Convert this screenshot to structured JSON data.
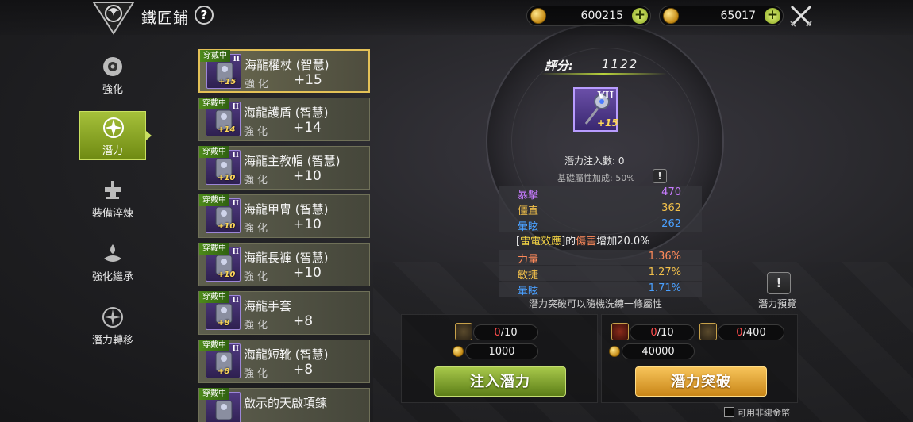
{
  "header": {
    "title": "鐵匠鋪",
    "help_label": "?",
    "currency_gold": "600215",
    "currency_coin": "65017"
  },
  "sidenav": {
    "items": [
      {
        "label": "強化",
        "icon": "enhance-icon",
        "active": false
      },
      {
        "label": "潛力",
        "icon": "potential-icon",
        "active": true
      },
      {
        "label": "裝備淬煉",
        "icon": "anvil-icon",
        "active": false
      },
      {
        "label": "強化繼承",
        "icon": "inherit-icon",
        "active": false
      },
      {
        "label": "潛力轉移",
        "icon": "transfer-icon",
        "active": false
      }
    ]
  },
  "equipment": {
    "wearing_badge": "穿戴中",
    "enhance_label": "強化",
    "items": [
      {
        "name": "海龍權杖 (智慧)",
        "enhance": "+15",
        "level": "+15",
        "tier": "II",
        "selected": true
      },
      {
        "name": "海龍護盾 (智慧)",
        "enhance": "+14",
        "level": "+14",
        "tier": "II",
        "selected": false
      },
      {
        "name": "海龍主教帽 (智慧)",
        "enhance": "+10",
        "level": "+10",
        "tier": "II",
        "selected": false
      },
      {
        "name": "海龍甲冑 (智慧)",
        "enhance": "+10",
        "level": "+10",
        "tier": "II",
        "selected": false
      },
      {
        "name": "海龍長褲 (智慧)",
        "enhance": "+10",
        "level": "+10",
        "tier": "II",
        "selected": false
      },
      {
        "name": "海龍手套",
        "enhance": "+8",
        "level": "+8",
        "tier": "II",
        "selected": false
      },
      {
        "name": "海龍短靴 (智慧)",
        "enhance": "+8",
        "level": "+8",
        "tier": "II",
        "selected": false
      },
      {
        "name": "啟示的天啟項鍊",
        "enhance": "",
        "level": "",
        "tier": "",
        "selected": false
      }
    ]
  },
  "detail": {
    "score_label": "評分:",
    "score_value": "1122",
    "item_tier": "VII",
    "item_level": "+15",
    "inject_count": "潛力注入數: 0",
    "base_bonus": "基礎屬性加成: 50%",
    "info_label": "!",
    "base_stats": [
      {
        "name": "暴擊",
        "value": "470",
        "name_color": "#c77bff",
        "value_color": "#c77bff"
      },
      {
        "name": "僵直",
        "value": "362",
        "name_color": "#f2c04a",
        "value_color": "#f2c04a"
      },
      {
        "name": "暈眩",
        "value": "262",
        "name_color": "#4aa0ff",
        "value_color": "#4aa0ff"
      }
    ],
    "special_prefix": "[",
    "special_effect": "雷電效應",
    "special_mid1": "]的",
    "special_target": "傷害",
    "special_suffix": "增加20.0%",
    "potential_stats": [
      {
        "name": "力量",
        "value": "1.36%",
        "name_color": "#ff8a5a",
        "value_color": "#ff8a5a"
      },
      {
        "name": "敏捷",
        "value": "1.27%",
        "name_color": "#f2c04a",
        "value_color": "#f2c04a"
      },
      {
        "name": "暈眩",
        "value": "1.71%",
        "name_color": "#4aa0ff",
        "value_color": "#4aa0ff"
      }
    ],
    "break_note": "潛力突破可以隨機洗練一條屬性",
    "preview_icon": "!",
    "preview_label": "潛力預覽"
  },
  "inject_panel": {
    "material_have": "0",
    "material_need": "/10",
    "gold_cost": "1000",
    "button_label": "注入潛力"
  },
  "break_panel": {
    "material1_have": "0",
    "material1_need": "/10",
    "material2_have": "0",
    "material2_need": "/400",
    "gold_cost": "40000",
    "button_label": "潛力突破"
  },
  "footer": {
    "unbound_label": "可用非綁金幣",
    "unbound_checked": false
  }
}
